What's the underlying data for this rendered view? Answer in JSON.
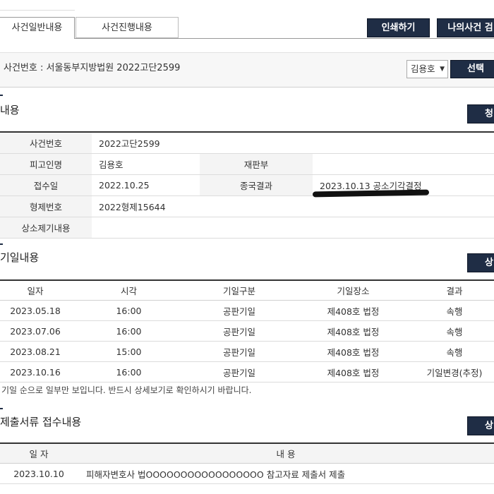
{
  "tabs": {
    "general": "사건일반내용",
    "progress": "사건진행내용"
  },
  "top_buttons": {
    "print": "인쇄하기",
    "my_case": "나의사건 검"
  },
  "search": {
    "case_label": "사건번호 : 서울동부지방법원 2022고단2599",
    "name_select": "김용호",
    "select_button": "선택"
  },
  "general": {
    "title": "내용",
    "right_button": "청",
    "rows": {
      "case_no_label": "사건번호",
      "case_no": "2022고단2599",
      "defendant_label": "피고인명",
      "defendant": "김용호",
      "court_label": "재판부",
      "court": "",
      "receipt_label": "접수일",
      "receipt": "2022.10.25",
      "result_label": "종국결과",
      "result": "2023.10.13 공소기각결정",
      "police_label": "형제번호",
      "police": "2022형제15644",
      "appeal_label": "상소제기내용",
      "appeal": ""
    }
  },
  "hearings": {
    "title": "기일내용",
    "right_button": "상",
    "headers": [
      "일자",
      "시각",
      "기일구분",
      "기일장소",
      "결과"
    ],
    "rows": [
      [
        "2023.05.18",
        "16:00",
        "공판기일",
        "제408호 법정",
        "속행"
      ],
      [
        "2023.07.06",
        "16:00",
        "공판기일",
        "제408호 법정",
        "속행"
      ],
      [
        "2023.08.21",
        "15:00",
        "공판기일",
        "제408호 법정",
        "속행"
      ],
      [
        "2023.10.16",
        "16:00",
        "공판기일",
        "제408호 법정",
        "기일변경(추정)"
      ]
    ],
    "note": "기일 순으로 일부만 보입니다. 반드시 상세보기로 확인하시기 바랍니다."
  },
  "submissions": {
    "title": "제출서류 접수내용",
    "right_button": "상",
    "headers": [
      "일 자",
      "내 용"
    ],
    "rows": [
      [
        "2023.10.10",
        "피해자변호사 법OOOOOOOOOOOOOOOOO 참고자료 제출서 제출"
      ]
    ]
  },
  "colors": {
    "button_bg": "#1f2d45",
    "label_bg": "#f4f4f4",
    "redaction": "#111111"
  }
}
